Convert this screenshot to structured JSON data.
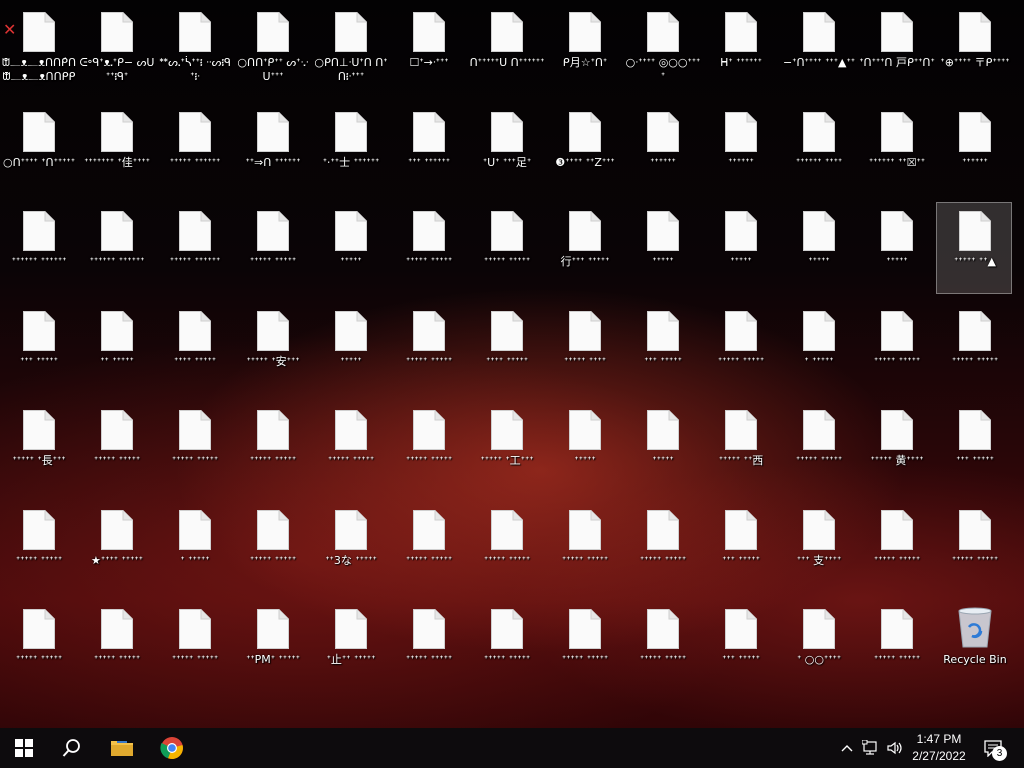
{
  "desktop": {
    "selected_index": 38,
    "icons": [
      "ᙧ᎗ᴥ᎗ᴥᑎᑎᑭ̂ᑎ ᙧ᎗ᴥ᎗ᴥᑎᑎᑭᑭᑎ",
      "ᕮ॰ᑫᐩᴥ᎐ᐩᑭ− ᔕᑌᐩᐩ᎒ᑫᐩ",
      "ᕯᔕ᎐ᐩᓵᐩᐩ᎒ ᐧᐧᔕ᎒ᑫᐩ᎒ᐧ",
      "○ᑎᑎᐩᑭᐩᐩ ᔕᐩᐧ᎐ᐧᑌᐩᐩᐩ",
      "○ᑭᑎ⊥ᐧᑌᐩᑎ ᑎᐩᑎ᎒ᐧᐩᐩᐩ",
      "☐ᐩ→ᐧᐩᐩᐩ",
      "ᑎᐩᐩᐩᐩᐩᑌ ᑎᐩᐩᐩᐩᐩᐩ",
      "ᑭ月☆ᐩᑎᐩ",
      "○ᐧᐩᐩᐩᐩ ◎○○ᐩᐩᐩᐩ",
      "ᕼᐩ ᐩᐩᐩᐩᐩᐩ",
      "−ᐩᑎᐩᐩᐩᐩ ᐩᐩᐩ▲ᐩᐩ",
      "ᐩᑎᐩᐩᐩᑎ 戸ᑭᐩᐩᑎᐩ",
      "ᐩ⊕ᐩᐩᐩᐩ 〒ᑭᐩᐩᐩᐩ",
      "○ᑎᐩᐩᐩᐩ ᐩᑎᐩᐩᐩᐩᐩ",
      "ᐩᐩᐩᐩᐩᐩᐩ ᐩ佳ᐩᐩᐩᐩ",
      "ᐩᐩᐩᐩᐩ ᐩᐩᐩᐩᐩᐩ",
      "ᐩᐩ⇒ᑎ ᐩᐩᐩᐩᐩᐩ",
      "ᐩ⋅ᐩᐩ士 ᐩᐩᐩᐩᐩᐩ",
      "ᐩᐩᐩ ᐩᐩᐩᐩᐩᐩ",
      "ᐩᑌᐩ ᐩᐩᐩ足ᐩ",
      "❸ᐩᐩᐩᐩ ᐩᐩZᐩᐩᐩ",
      "ᐩᐩᐩᐩᐩᐩ",
      "ᐩᐩᐩᐩᐩᐩ",
      "ᐩᐩᐩᐩᐩᐩ ᐩᐩᐩᐩ",
      "ᐩᐩᐩᐩᐩᐩ ᐩᐩ☒ᐩᐩ",
      "ᐩᐩᐩᐩᐩᐩ",
      "ᐩᐩᐩᐩᐩᐩ ᐩᐩᐩᐩᐩᐩ",
      "ᐩᐩᐩᐩᐩᐩ ᐩᐩᐩᐩᐩᐩ",
      "ᐩᐩᐩᐩᐩ ᐩᐩᐩᐩᐩᐩ",
      "ᐩᐩᐩᐩᐩ ᐩᐩᐩᐩᐩ",
      "ᐩᐩᐩᐩᐩ",
      "ᐩᐩᐩᐩᐩ ᐩᐩᐩᐩᐩ",
      "ᐩᐩᐩᐩᐩ ᐩᐩᐩᐩᐩ",
      "行ᐩᐩᐩ ᐩᐩᐩᐩᐩ",
      "ᐩᐩᐩᐩᐩ",
      "ᐩᐩᐩᐩᐩ",
      "ᐩᐩᐩᐩᐩ",
      "ᐩᐩᐩᐩᐩ",
      "ᐩᐩᐩᐩᐩ ᐩᐩ▲",
      "ᐩᐩᐩ ᐩᐩᐩᐩᐩ",
      "ᐩᐩ ᐩᐩᐩᐩᐩ",
      "ᐩᐩᐩᐩ ᐩᐩᐩᐩᐩ",
      "ᐩᐩᐩᐩᐩ ᐩ安ᐩᐩᐩ",
      "ᐩᐩᐩᐩᐩ",
      "ᐩᐩᐩᐩᐩ ᐩᐩᐩᐩᐩ",
      "ᐩᐩᐩᐩ ᐩᐩᐩᐩᐩ",
      "ᐩᐩᐩᐩᐩ ᐩᐩᐩᐩ",
      "ᐩᐩᐩ ᐩᐩᐩᐩᐩ",
      "ᐩᐩᐩᐩᐩ ᐩᐩᐩᐩᐩ",
      "ᐩ ᐩᐩᐩᐩᐩ",
      "ᐩᐩᐩᐩᐩ ᐩᐩᐩᐩᐩ",
      "ᐩᐩᐩᐩᐩ ᐩᐩᐩᐩᐩ",
      "ᐩᐩᐩᐩᐩ ᐩ長ᐩᐩᐩ",
      "ᐩᐩᐩᐩᐩ ᐩᐩᐩᐩᐩ",
      "ᐩᐩᐩᐩᐩ ᐩᐩᐩᐩᐩ",
      "ᐩᐩᐩᐩᐩ ᐩᐩᐩᐩᐩ",
      "ᐩᐩᐩᐩᐩ ᐩᐩᐩᐩᐩ",
      "ᐩᐩᐩᐩᐩ ᐩᐩᐩᐩᐩ",
      "ᐩᐩᐩᐩᐩ ᐩ工ᐩᐩᐩ",
      "ᐩᐩᐩᐩᐩ",
      "ᐩᐩᐩᐩᐩ",
      "ᐩᐩᐩᐩᐩ ᐩᐩ西",
      "ᐩᐩᐩᐩᐩ ᐩᐩᐩᐩᐩ",
      "ᐩᐩᐩᐩᐩ 黄ᐩᐩᐩᐩ",
      "ᐩᐩᐩ ᐩᐩᐩᐩᐩ",
      "ᐩᐩᐩᐩᐩ ᐩᐩᐩᐩᐩ",
      "★ᐩᐩᐩᐩ ᐩᐩᐩᐩᐩ",
      "ᐩ ᐩᐩᐩᐩᐩ",
      "ᐩᐩᐩᐩᐩ ᐩᐩᐩᐩᐩ",
      "ᐩᐩ3な ᐩᐩᐩᐩᐩ",
      "ᐩᐩᐩᐩᐩ ᐩᐩᐩᐩᐩ",
      "ᐩᐩᐩᐩᐩ ᐩᐩᐩᐩᐩ",
      "ᐩᐩᐩᐩᐩ ᐩᐩᐩᐩᐩ",
      "ᐩᐩᐩᐩᐩ ᐩᐩᐩᐩᐩ",
      "ᐩᐩᐩ ᐩᐩᐩᐩᐩ",
      "ᐩᐩᐩ 支ᐩᐩᐩᐩ",
      "ᐩᐩᐩᐩᐩ ᐩᐩᐩᐩᐩ",
      "ᐩᐩᐩᐩᐩ ᐩᐩᐩᐩᐩ",
      "ᐩᐩᐩᐩᐩ ᐩᐩᐩᐩᐩ",
      "ᐩᐩᐩᐩᐩ ᐩᐩᐩᐩᐩ",
      "ᐩᐩᐩᐩᐩ ᐩᐩᐩᐩᐩ",
      "ᐩᐩPMᐩ ᐩᐩᐩᐩᐩ",
      "ᐩ止ᐩᐩ ᐩᐩᐩᐩᐩ",
      "ᐩᐩᐩᐩᐩ ᐩᐩᐩᐩᐩ",
      "ᐩᐩᐩᐩᐩ ᐩᐩᐩᐩᐩ",
      "ᐩᐩᐩᐩᐩ ᐩᐩᐩᐩᐩ",
      "ᐩᐩᐩᐩᐩ ᐩᐩᐩᐩᐩ",
      "ᐩᐩᐩ ᐩᐩᐩᐩᐩ",
      "ᐩ ○○ᐩᐩᐩᐩ",
      "ᐩᐩᐩᐩᐩ ᐩᐩᐩᐩᐩ"
    ],
    "recycle_bin_label": "Recycle Bin"
  },
  "taskbar": {
    "start_icon": "windows-logo-icon",
    "search_icon": "search-icon",
    "explorer_icon": "folder-icon",
    "chrome_icon": "chrome-icon",
    "time": "1:47 PM",
    "date": "2/27/2022",
    "notification_count": "3"
  },
  "colors": {
    "taskbar_bg": "#0d0b0d",
    "folder_yellow": "#f4c24a",
    "chrome_red": "#db4437",
    "chrome_yellow": "#f4b400",
    "chrome_green": "#0f9d58",
    "chrome_blue": "#4285f4"
  }
}
